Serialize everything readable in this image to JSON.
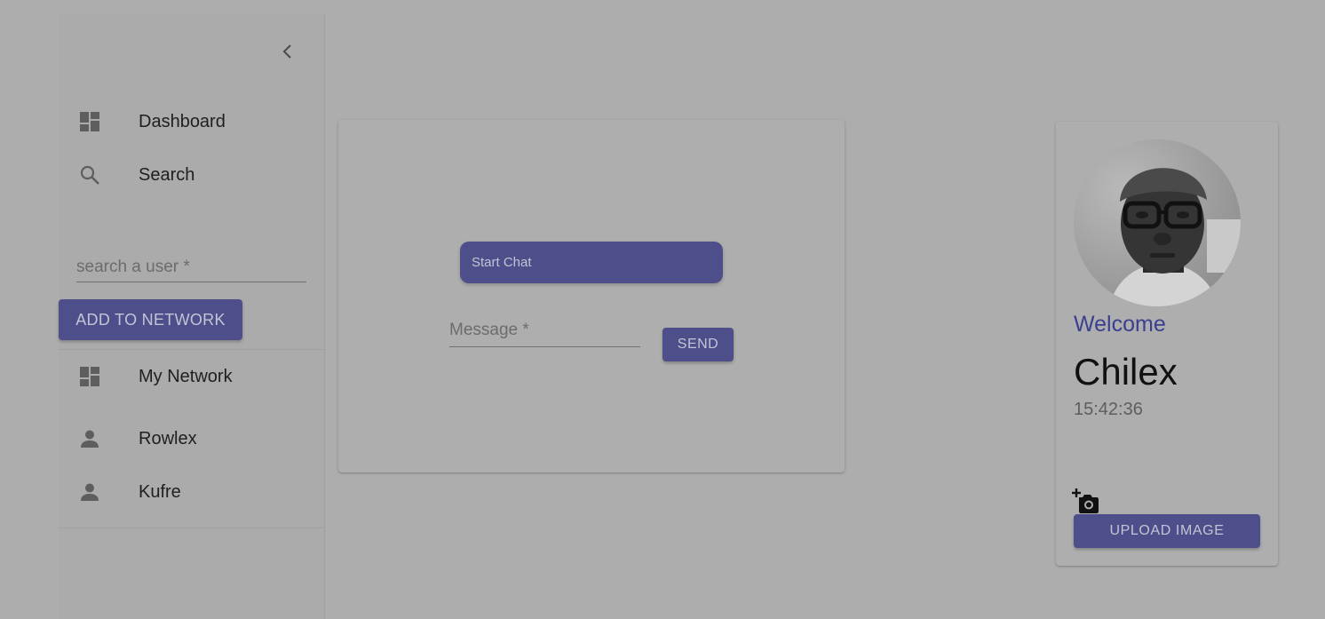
{
  "sidebar": {
    "collapse_icon": "chevron-left-icon",
    "items": [
      {
        "label": "Dashboard",
        "icon": "dashboard-icon"
      },
      {
        "label": "Search",
        "icon": "search-icon"
      }
    ],
    "search": {
      "placeholder": "search a user *",
      "value": ""
    },
    "add_button": "ADD TO NETWORK",
    "network": {
      "label": "My Network",
      "icon": "dashboard-icon"
    },
    "contacts": [
      {
        "name": "Rowlex",
        "icon": "person-icon"
      },
      {
        "name": "Kufre",
        "icon": "person-icon"
      }
    ]
  },
  "chat": {
    "start_chat": "Start Chat",
    "message": {
      "placeholder": "Message *",
      "value": ""
    },
    "send_button": "SEND"
  },
  "profile": {
    "welcome": "Welcome",
    "name": "Chilex",
    "time": "15:42:36",
    "upload_icon": "add-photo-icon",
    "upload_button": "UPLOAD IMAGE"
  },
  "colors": {
    "primary": "#4e4f8a",
    "button_text": "#c3c4d5",
    "welcome_text": "#3a3f8f",
    "backdrop": "#adadad"
  }
}
